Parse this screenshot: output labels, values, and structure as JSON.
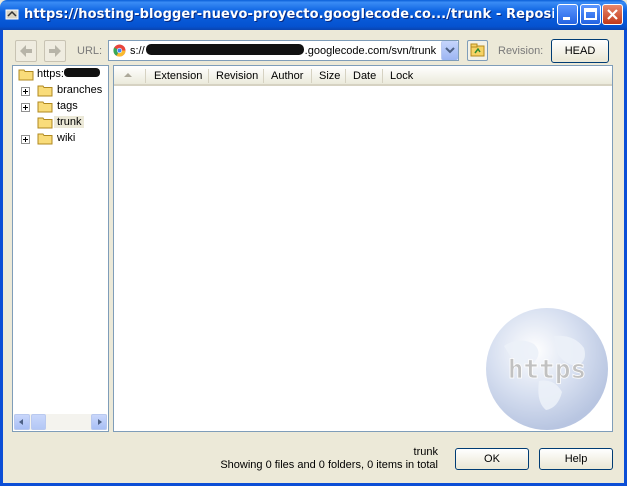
{
  "window": {
    "title": "https://hosting-blogger-nuevo-proyecto.googlecode.co.../trunk - Repository Brows..."
  },
  "toolbar": {
    "url_label": "URL:",
    "url_prefix": "s://",
    "url_suffix": ".googlecode.com/svn/trunk",
    "revision_label": "Revision:",
    "head_button": "HEAD"
  },
  "tree": {
    "root_prefix": "https:",
    "items": [
      {
        "label": "branches",
        "expandable": true
      },
      {
        "label": "tags",
        "expandable": true
      },
      {
        "label": "trunk",
        "expandable": false,
        "selected": true
      },
      {
        "label": "wiki",
        "expandable": true
      }
    ]
  },
  "list": {
    "columns": [
      "Extension",
      "Revision",
      "Author",
      "Size",
      "Date",
      "Lock"
    ],
    "rows": []
  },
  "watermark_text": "https",
  "footer": {
    "current_path": "trunk",
    "summary": "Showing 0 files and 0 folders, 0 items in total",
    "ok_button": "OK",
    "help_button": "Help"
  },
  "colors": {
    "titlebar": "#0b61e0",
    "window_bg": "#ece9d8",
    "close_button": "#c2391a"
  }
}
